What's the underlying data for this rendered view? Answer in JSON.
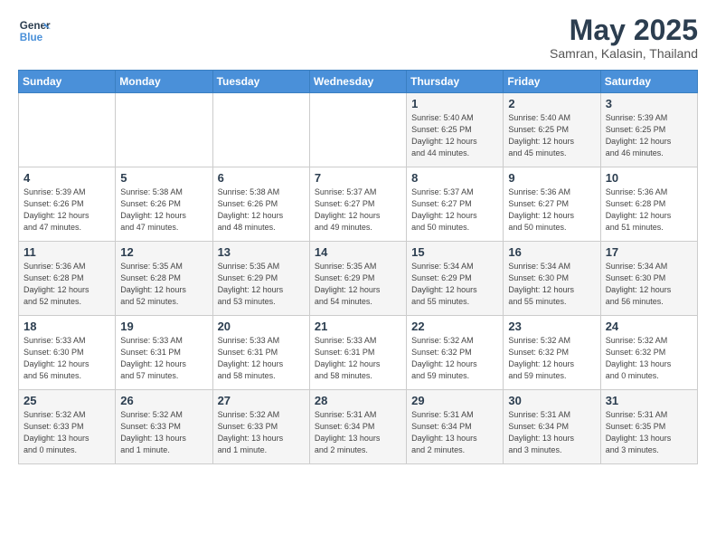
{
  "header": {
    "logo_line1": "General",
    "logo_line2": "Blue",
    "month": "May 2025",
    "location": "Samran, Kalasin, Thailand"
  },
  "weekdays": [
    "Sunday",
    "Monday",
    "Tuesday",
    "Wednesday",
    "Thursday",
    "Friday",
    "Saturday"
  ],
  "weeks": [
    [
      {
        "day": "",
        "info": ""
      },
      {
        "day": "",
        "info": ""
      },
      {
        "day": "",
        "info": ""
      },
      {
        "day": "",
        "info": ""
      },
      {
        "day": "1",
        "info": "Sunrise: 5:40 AM\nSunset: 6:25 PM\nDaylight: 12 hours\nand 44 minutes."
      },
      {
        "day": "2",
        "info": "Sunrise: 5:40 AM\nSunset: 6:25 PM\nDaylight: 12 hours\nand 45 minutes."
      },
      {
        "day": "3",
        "info": "Sunrise: 5:39 AM\nSunset: 6:25 PM\nDaylight: 12 hours\nand 46 minutes."
      }
    ],
    [
      {
        "day": "4",
        "info": "Sunrise: 5:39 AM\nSunset: 6:26 PM\nDaylight: 12 hours\nand 47 minutes."
      },
      {
        "day": "5",
        "info": "Sunrise: 5:38 AM\nSunset: 6:26 PM\nDaylight: 12 hours\nand 47 minutes."
      },
      {
        "day": "6",
        "info": "Sunrise: 5:38 AM\nSunset: 6:26 PM\nDaylight: 12 hours\nand 48 minutes."
      },
      {
        "day": "7",
        "info": "Sunrise: 5:37 AM\nSunset: 6:27 PM\nDaylight: 12 hours\nand 49 minutes."
      },
      {
        "day": "8",
        "info": "Sunrise: 5:37 AM\nSunset: 6:27 PM\nDaylight: 12 hours\nand 50 minutes."
      },
      {
        "day": "9",
        "info": "Sunrise: 5:36 AM\nSunset: 6:27 PM\nDaylight: 12 hours\nand 50 minutes."
      },
      {
        "day": "10",
        "info": "Sunrise: 5:36 AM\nSunset: 6:28 PM\nDaylight: 12 hours\nand 51 minutes."
      }
    ],
    [
      {
        "day": "11",
        "info": "Sunrise: 5:36 AM\nSunset: 6:28 PM\nDaylight: 12 hours\nand 52 minutes."
      },
      {
        "day": "12",
        "info": "Sunrise: 5:35 AM\nSunset: 6:28 PM\nDaylight: 12 hours\nand 52 minutes."
      },
      {
        "day": "13",
        "info": "Sunrise: 5:35 AM\nSunset: 6:29 PM\nDaylight: 12 hours\nand 53 minutes."
      },
      {
        "day": "14",
        "info": "Sunrise: 5:35 AM\nSunset: 6:29 PM\nDaylight: 12 hours\nand 54 minutes."
      },
      {
        "day": "15",
        "info": "Sunrise: 5:34 AM\nSunset: 6:29 PM\nDaylight: 12 hours\nand 55 minutes."
      },
      {
        "day": "16",
        "info": "Sunrise: 5:34 AM\nSunset: 6:30 PM\nDaylight: 12 hours\nand 55 minutes."
      },
      {
        "day": "17",
        "info": "Sunrise: 5:34 AM\nSunset: 6:30 PM\nDaylight: 12 hours\nand 56 minutes."
      }
    ],
    [
      {
        "day": "18",
        "info": "Sunrise: 5:33 AM\nSunset: 6:30 PM\nDaylight: 12 hours\nand 56 minutes."
      },
      {
        "day": "19",
        "info": "Sunrise: 5:33 AM\nSunset: 6:31 PM\nDaylight: 12 hours\nand 57 minutes."
      },
      {
        "day": "20",
        "info": "Sunrise: 5:33 AM\nSunset: 6:31 PM\nDaylight: 12 hours\nand 58 minutes."
      },
      {
        "day": "21",
        "info": "Sunrise: 5:33 AM\nSunset: 6:31 PM\nDaylight: 12 hours\nand 58 minutes."
      },
      {
        "day": "22",
        "info": "Sunrise: 5:32 AM\nSunset: 6:32 PM\nDaylight: 12 hours\nand 59 minutes."
      },
      {
        "day": "23",
        "info": "Sunrise: 5:32 AM\nSunset: 6:32 PM\nDaylight: 12 hours\nand 59 minutes."
      },
      {
        "day": "24",
        "info": "Sunrise: 5:32 AM\nSunset: 6:32 PM\nDaylight: 13 hours\nand 0 minutes."
      }
    ],
    [
      {
        "day": "25",
        "info": "Sunrise: 5:32 AM\nSunset: 6:33 PM\nDaylight: 13 hours\nand 0 minutes."
      },
      {
        "day": "26",
        "info": "Sunrise: 5:32 AM\nSunset: 6:33 PM\nDaylight: 13 hours\nand 1 minute."
      },
      {
        "day": "27",
        "info": "Sunrise: 5:32 AM\nSunset: 6:33 PM\nDaylight: 13 hours\nand 1 minute."
      },
      {
        "day": "28",
        "info": "Sunrise: 5:31 AM\nSunset: 6:34 PM\nDaylight: 13 hours\nand 2 minutes."
      },
      {
        "day": "29",
        "info": "Sunrise: 5:31 AM\nSunset: 6:34 PM\nDaylight: 13 hours\nand 2 minutes."
      },
      {
        "day": "30",
        "info": "Sunrise: 5:31 AM\nSunset: 6:34 PM\nDaylight: 13 hours\nand 3 minutes."
      },
      {
        "day": "31",
        "info": "Sunrise: 5:31 AM\nSunset: 6:35 PM\nDaylight: 13 hours\nand 3 minutes."
      }
    ]
  ]
}
